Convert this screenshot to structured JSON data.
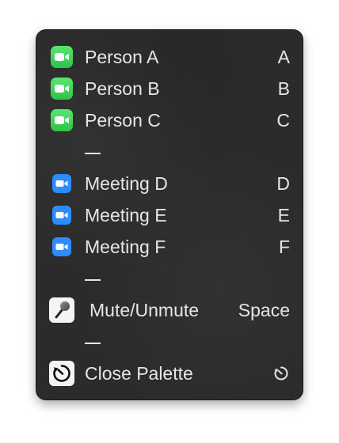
{
  "palette": {
    "items": [
      {
        "type": "facetime",
        "label": "Person A",
        "key": "A",
        "icon": "facetime-video-icon"
      },
      {
        "type": "facetime",
        "label": "Person B",
        "key": "B",
        "icon": "facetime-video-icon"
      },
      {
        "type": "facetime",
        "label": "Person C",
        "key": "C",
        "icon": "facetime-video-icon"
      },
      {
        "type": "zoom",
        "label": "Meeting D",
        "key": "D",
        "icon": "zoom-video-icon"
      },
      {
        "type": "zoom",
        "label": "Meeting E",
        "key": "E",
        "icon": "zoom-video-icon"
      },
      {
        "type": "zoom",
        "label": "Meeting F",
        "key": "F",
        "icon": "zoom-video-icon"
      }
    ],
    "mute": {
      "label": "Mute/Unmute",
      "key": "Space",
      "icon": "microphone-icon"
    },
    "close": {
      "label": "Close Palette",
      "key_icon": "timer-reset-icon",
      "icon": "timer-reset-icon"
    }
  },
  "colors": {
    "background": "#2b2b2b",
    "text": "#e6e6e6",
    "facetime_green": "#34c759",
    "zoom_blue": "#2d8cff"
  }
}
